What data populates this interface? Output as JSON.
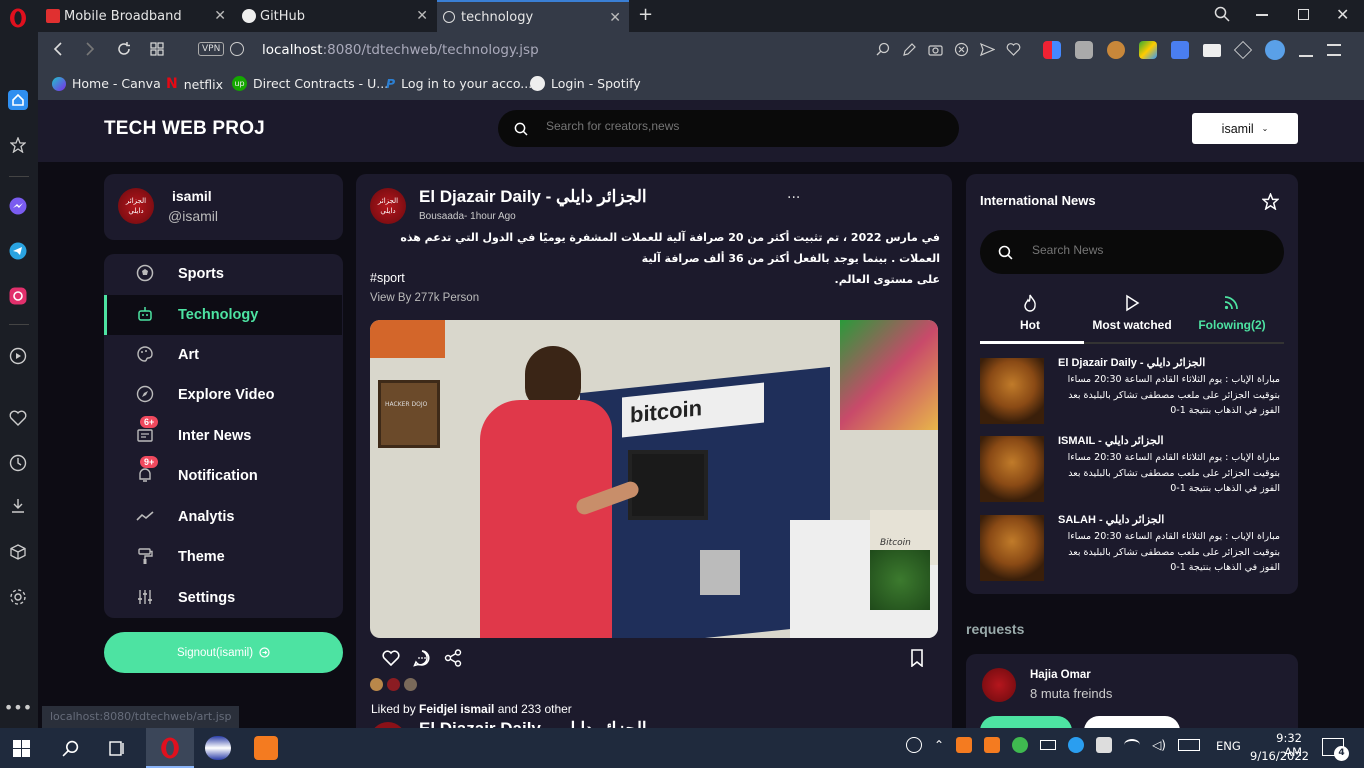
{
  "browser": {
    "tabs": [
      {
        "title": "Mobile Broadband"
      },
      {
        "title": "GitHub"
      },
      {
        "title": "technology"
      }
    ],
    "vpn_label": "VPN",
    "url_host": "localhost",
    "url_path": ":8080/tdtechweb/technology.jsp",
    "bookmarks": [
      "Home - Canva",
      "netflix",
      "Direct Contracts - U...",
      "Log in to your acco...",
      "Login - Spotify"
    ],
    "status_url": "localhost:8080/tdtechweb/art.jsp"
  },
  "header": {
    "logo": "TECH WEB PROJ",
    "search_placeholder": "Search for creators,news",
    "user_button": "isamil"
  },
  "profile": {
    "name": "isamil",
    "handle": "@isamil",
    "avatar_text": "الجزائر دايلي"
  },
  "menu": [
    {
      "label": "Sports",
      "icon": "soccer-ball-icon",
      "active": false
    },
    {
      "label": "Technology",
      "icon": "robot-icon",
      "active": true
    },
    {
      "label": "Art",
      "icon": "palette-icon",
      "active": false
    },
    {
      "label": "Explore Video",
      "icon": "compass-icon",
      "active": false
    },
    {
      "label": "Inter News",
      "icon": "news-icon",
      "active": false,
      "badge": "6+"
    },
    {
      "label": "Notification",
      "icon": "bell-icon",
      "active": false,
      "badge": "9+"
    },
    {
      "label": "Analytis",
      "icon": "chart-line-icon",
      "active": false
    },
    {
      "label": "Theme",
      "icon": "paint-roller-icon",
      "active": false
    },
    {
      "label": "Settings",
      "icon": "sliders-icon",
      "active": false
    }
  ],
  "signout_label": "Signout(isamil)",
  "post": {
    "author": "El Djazair Daily - الجزائر دايلي",
    "meta": "Bousaada- 1hour Ago",
    "body_line1": "في مارس 2022 ، تم تثبيت أكثر من 20 صرافة آلية للعملات المشفرة يوميًا في الدول التي تدعم هذه العملات . بينما يوجد بالفعل أكثر من 36 ألف صرافة آلية",
    "body_line2": "على مستوى العالم.",
    "tag": "#sport",
    "views": "View By 277k Person",
    "liked_prefix": "Liked by ",
    "liked_user": "Feidjel ismail",
    "liked_suffix": " and 233 other",
    "image_sign": "bitcoin",
    "image_sign2": "Bitcoin",
    "image_sign3": "HACKER DOJO",
    "more_icon": "..."
  },
  "news": {
    "title": "International News",
    "search_placeholder": "Search News",
    "tabs": [
      {
        "label": "Hot",
        "active": true
      },
      {
        "label": "Most watched",
        "active": false
      },
      {
        "label": "Folowing(2)",
        "active": false
      }
    ],
    "items": [
      {
        "title": "El Djazair Daily - الجزائر دايلي",
        "body": "مباراة الإياب : يوم الثلاثاء القادم الساعة 20:30 مساءا بتوقيت الجزائر على ملعب مصطفى تشاكر بالبليدة بعد الفوز في الذهاب بنتيجة 1-0"
      },
      {
        "title": "ISMAIL - الجزائر دايلي",
        "body": "مباراة الإياب : يوم الثلاثاء القادم الساعة 20:30 مساءا بتوقيت الجزائر على ملعب مصطفى تشاكر بالبليدة بعد الفوز في الذهاب بنتيجة 1-0"
      },
      {
        "title": "SALAH - الجزائر دايلي",
        "body": "مباراة الإياب : يوم الثلاثاء القادم الساعة 20:30 مساءا بتوقيت الجزائر على ملعب مصطفى تشاكر بالبليدة بعد الفوز في الذهاب بنتيجة 1-0"
      }
    ]
  },
  "requests": {
    "title": "requests",
    "name": "Hajia Omar",
    "mutual": "8 muta freinds"
  },
  "taskbar": {
    "time": "9:32 AM",
    "date": "9/16/2022",
    "lang": "ENG",
    "notifications": "4"
  },
  "colors": {
    "accent": "#4de3a2",
    "bg": "#0d0c14",
    "card": "#1c1a2c",
    "badge": "#f0495e"
  }
}
